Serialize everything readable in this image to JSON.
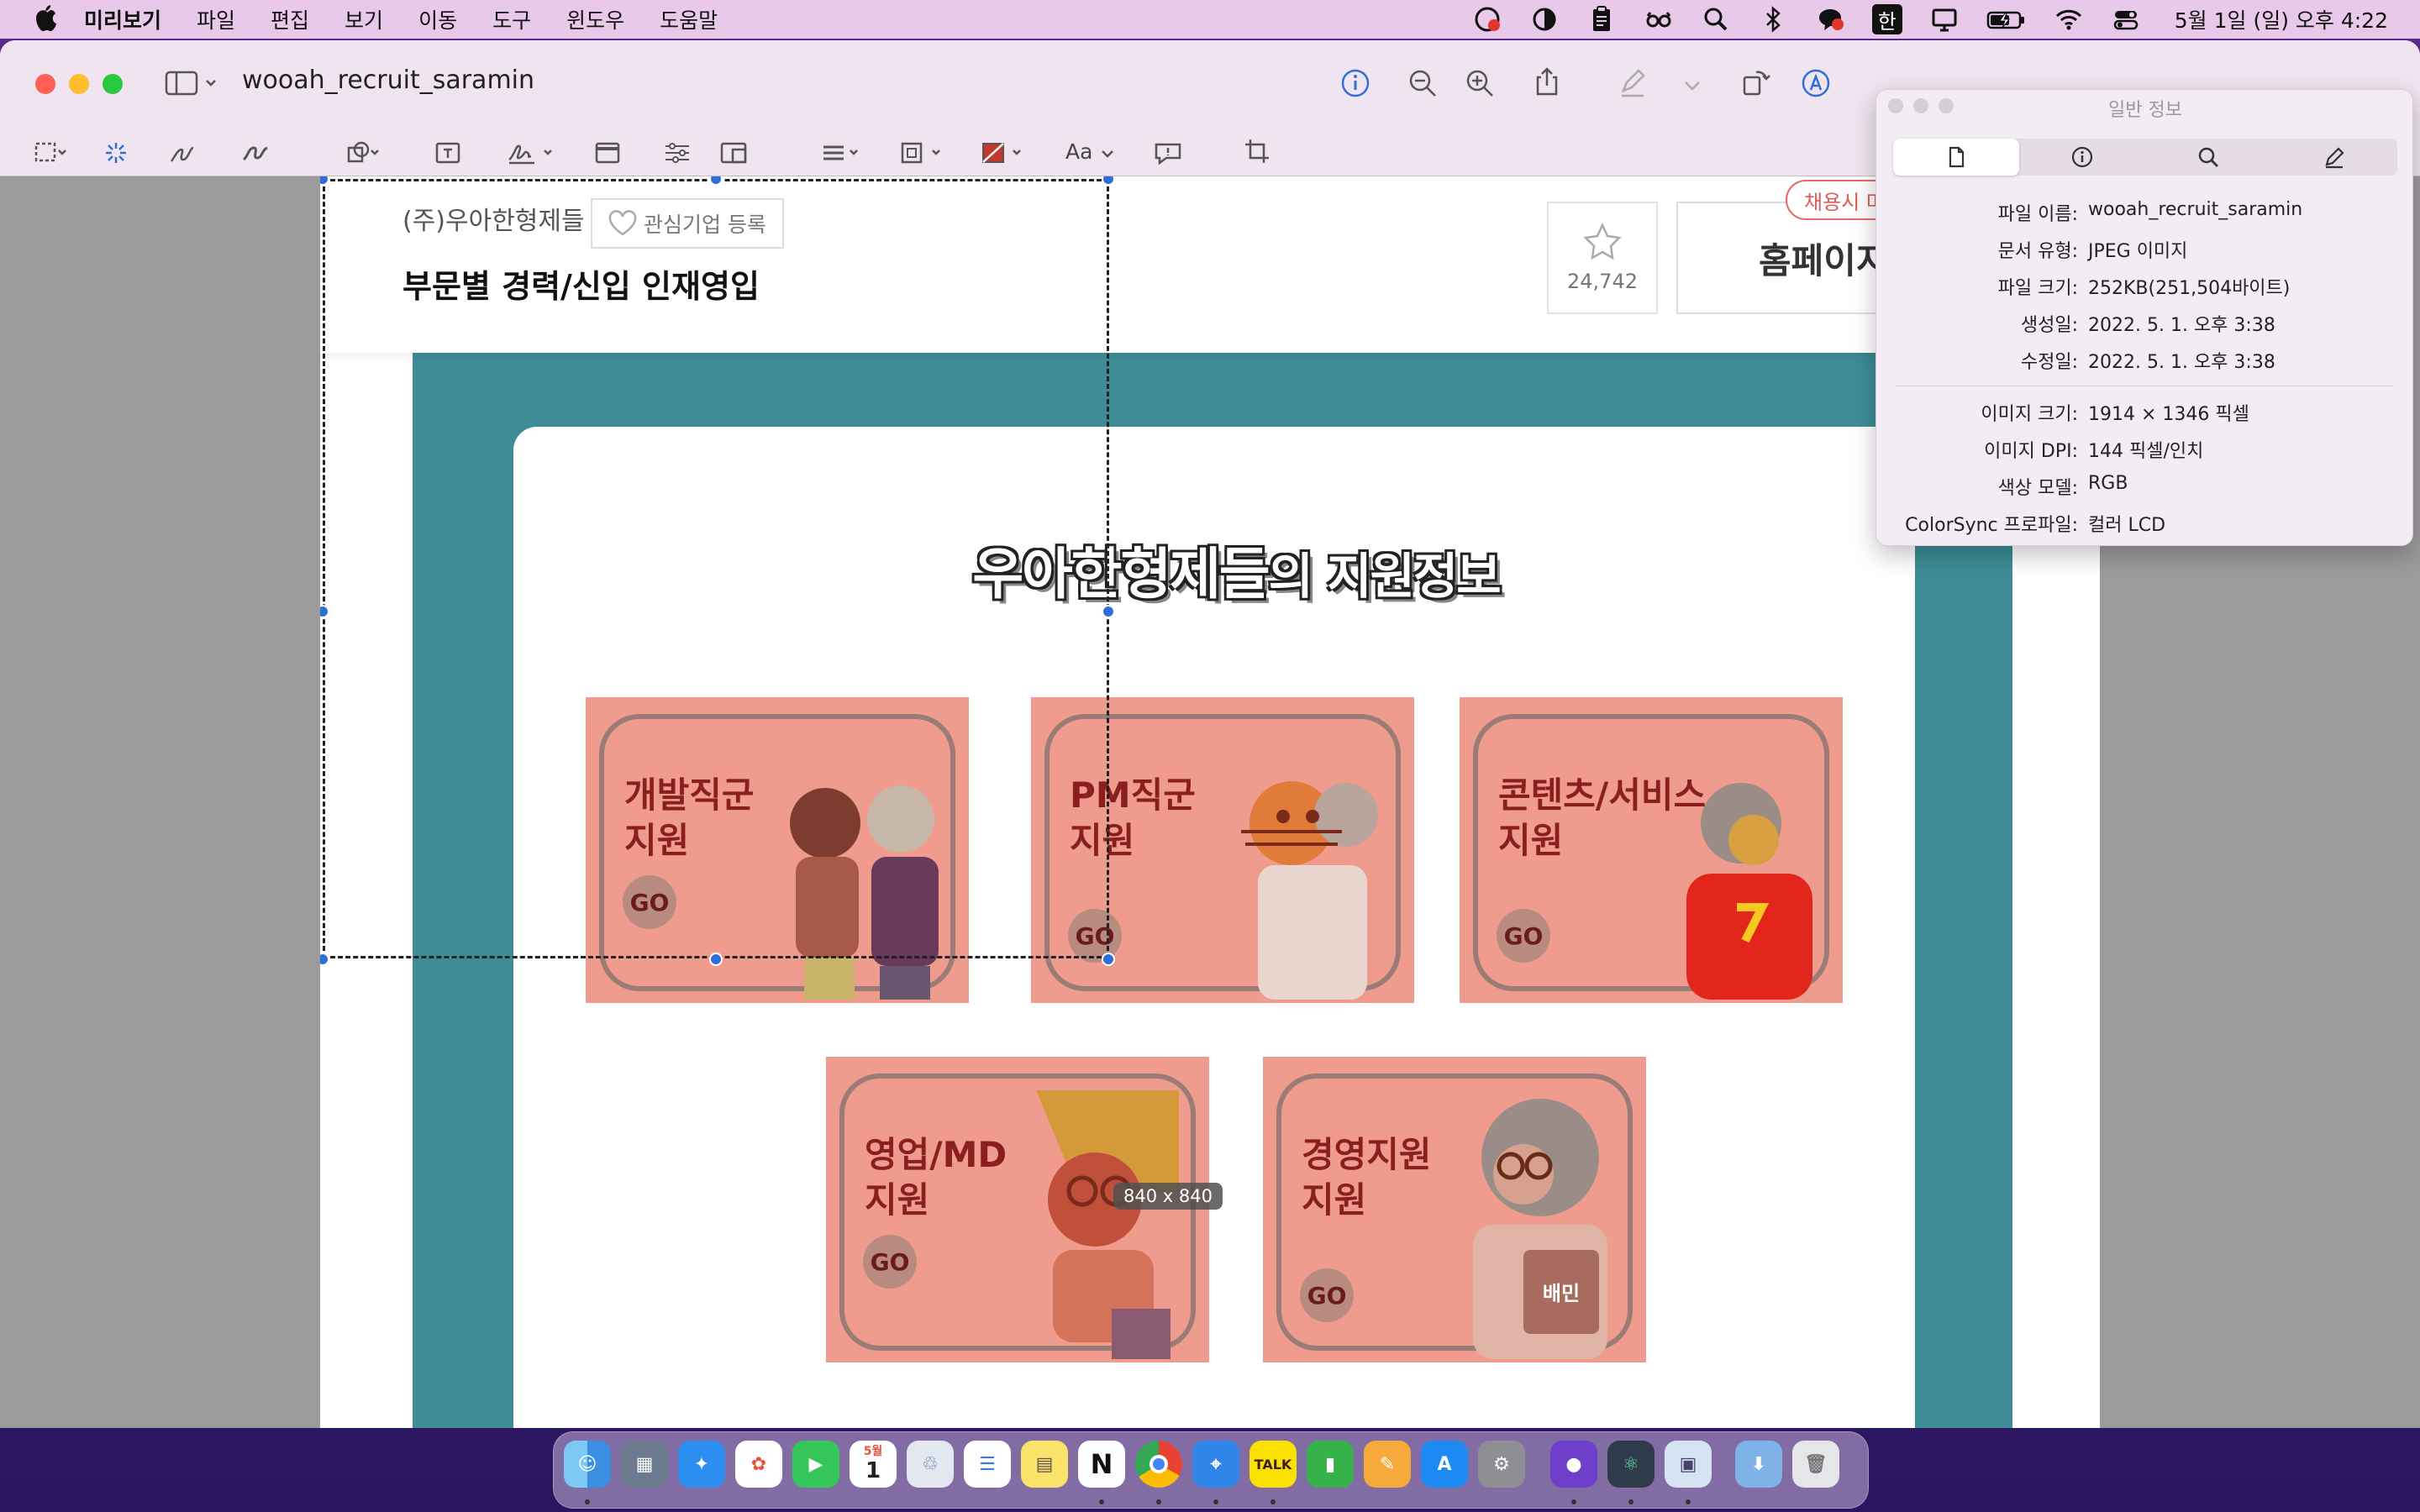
{
  "menubar": {
    "app_name": "미리보기",
    "items": [
      "파일",
      "편집",
      "보기",
      "이동",
      "도구",
      "윈도우",
      "도움말"
    ],
    "clock": "5월 1일 (일) 오후 4:22",
    "input_method": "한"
  },
  "window": {
    "title": "wooah_recruit_saramin"
  },
  "toolbar": {
    "font_label": "Aa"
  },
  "page": {
    "company": "(주)우아한형제들",
    "favorite_label": "관심기업 등록",
    "job_title": "부문별 경력/신입 인재영입",
    "star_count": "24,742",
    "homepage_label": "홈페이지",
    "recruit_tag": "채용시 마",
    "support_title_main": "우아한형제들",
    "support_title_suffix": "의 지원정보",
    "tiles": [
      {
        "line1": "개발직군",
        "line2": "지원",
        "go": "GO"
      },
      {
        "line1": "PM직군",
        "line2": "지원",
        "go": "GO"
      },
      {
        "line1": "콘텐츠/서비스",
        "line2": "지원",
        "go": "GO"
      },
      {
        "line1": "영업/MD",
        "line2": "지원",
        "go": "GO"
      },
      {
        "line1": "경영지원",
        "line2": "지원",
        "go": "GO"
      }
    ],
    "character_badge": "배민",
    "selection_size": "840 x 840"
  },
  "info_panel": {
    "title": "일반 정보",
    "tabs": [
      "document-icon",
      "info-icon",
      "search-icon",
      "pencil-icon"
    ],
    "rows": [
      {
        "key": "파일 이름:",
        "value": "wooah_recruit_saramin"
      },
      {
        "key": "문서 유형:",
        "value": "JPEG 이미지"
      },
      {
        "key": "파일 크기:",
        "value": "252KB(251,504바이트)"
      },
      {
        "key": "생성일:",
        "value": "2022. 5. 1. 오후 3:38"
      },
      {
        "key": "수정일:",
        "value": "2022. 5. 1. 오후 3:38"
      },
      {
        "key": "이미지 크기:",
        "value": "1914 × 1346 픽셀"
      },
      {
        "key": "이미지 DPI:",
        "value": "144 픽셀/인치"
      },
      {
        "key": "색상 모델:",
        "value": "RGB"
      },
      {
        "key": "ColorSync 프로파일:",
        "value": "컬러 LCD"
      }
    ]
  },
  "dock": {
    "apps": [
      "finder-icon",
      "launchpad-icon",
      "safari-icon",
      "photos-icon",
      "facetime-icon",
      "calendar-icon",
      "recycle-icon",
      "reminders-icon",
      "notes-icon",
      "notion-icon",
      "chrome-icon",
      "keynote-icon",
      "kakaotalk-icon",
      "numbers-icon",
      "pages-icon",
      "app-store-icon",
      "system-preferences-icon",
      "github-icon",
      "atom-icon",
      "preview-icon",
      "downloads-folder-icon",
      "trash-icon"
    ],
    "calendar_month": "5월",
    "calendar_day": "1",
    "kakao_label": "TALK",
    "notion_label": "N"
  },
  "colors": {
    "menubar_bg": "#e8c9ea",
    "teal": "#3e8d96",
    "tile_bg": "#ef9c8e",
    "tile_text": "#8a1f1f",
    "selection_handle": "#2d6fd6"
  }
}
